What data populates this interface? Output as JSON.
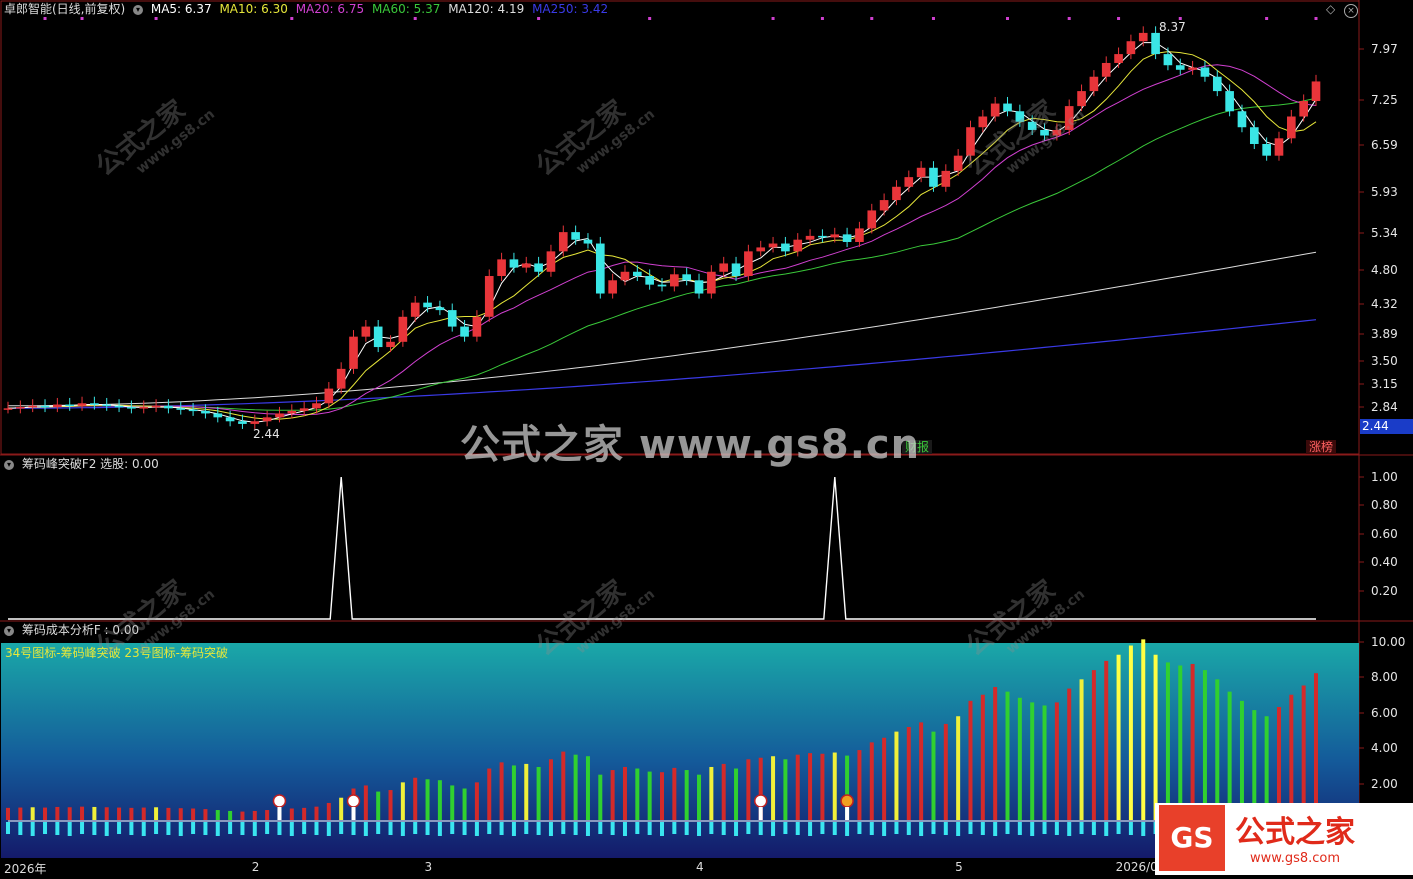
{
  "main_panel": {
    "title": "卓郎智能(日线,前复权)",
    "ma": [
      {
        "label": "MA5: 6.37",
        "color": "#ffffff"
      },
      {
        "label": "MA10: 6.30",
        "color": "#e6e63a"
      },
      {
        "label": "MA20: 6.75",
        "color": "#d040d0"
      },
      {
        "label": "MA60: 5.37",
        "color": "#3ac83a"
      },
      {
        "label": "MA120: 4.19",
        "color": "#dddddd"
      },
      {
        "label": "MA250: 3.42",
        "color": "#3a3ae6"
      }
    ],
    "y_ticks": [
      "7.97",
      "7.25",
      "6.59",
      "5.93",
      "5.34",
      "4.80",
      "4.32",
      "3.89",
      "3.50",
      "3.15",
      "2.84"
    ],
    "current_price": "2.44",
    "high_label": "8.37",
    "low_label": "2.44",
    "tag_finance": "财报",
    "tag_limit": "涨榜"
  },
  "indicator1": {
    "title": "筹码峰突破F2  选股: 0.00",
    "y_ticks": [
      "1.00",
      "0.80",
      "0.60",
      "0.40",
      "0.20"
    ],
    "spikes_at_candle": [
      27,
      67
    ]
  },
  "indicator2": {
    "title": "筹码成本分析F : 0.00",
    "legend": "34号图标-筹码峰突破  23号图标-筹码突破",
    "y_ticks": [
      "10.00",
      "8.00",
      "6.00",
      "4.00",
      "2.00"
    ]
  },
  "x_axis": {
    "labels": [
      {
        "text": "2026年",
        "at": 0
      },
      {
        "text": "2",
        "at": 20
      },
      {
        "text": "3",
        "at": 34
      },
      {
        "text": "4",
        "at": 56
      },
      {
        "text": "5",
        "at": 77
      },
      {
        "text": "2026/05/22/",
        "at": 90
      }
    ]
  },
  "watermark": {
    "center": "公式之家 www.gs8.cn",
    "tile_cn": "公式之家",
    "tile_url": "www.gs8.cn"
  },
  "logo": {
    "mark": "GS",
    "name": "公式之家",
    "url": "www.gs8.com"
  },
  "colors": {
    "up": "#e8353a",
    "down": "#3ae6e6",
    "ma5": "#ffffff",
    "ma10": "#e6e63a",
    "ma20": "#d040d0",
    "ma60": "#3ac83a",
    "ma120": "#dddddd",
    "ma250": "#3a3ae6"
  },
  "chart_data": {
    "type": "candlestick",
    "closes": [
      2.62,
      2.63,
      2.64,
      2.63,
      2.65,
      2.64,
      2.66,
      2.65,
      2.64,
      2.63,
      2.62,
      2.63,
      2.64,
      2.62,
      2.61,
      2.6,
      2.58,
      2.55,
      2.52,
      2.5,
      2.52,
      2.55,
      2.58,
      2.6,
      2.62,
      2.66,
      2.78,
      2.95,
      3.25,
      3.35,
      3.15,
      3.2,
      3.45,
      3.6,
      3.55,
      3.52,
      3.35,
      3.25,
      3.45,
      3.9,
      4.1,
      4.0,
      4.05,
      3.95,
      4.2,
      4.45,
      4.35,
      4.3,
      3.7,
      3.85,
      3.95,
      3.9,
      3.8,
      3.78,
      3.92,
      3.85,
      3.7,
      3.95,
      4.05,
      3.9,
      4.2,
      4.25,
      4.3,
      4.2,
      4.35,
      4.4,
      4.38,
      4.42,
      4.32,
      4.5,
      4.75,
      4.9,
      5.1,
      5.25,
      5.4,
      5.1,
      5.35,
      5.6,
      6.1,
      6.3,
      6.55,
      6.4,
      6.2,
      6.05,
      5.95,
      6.05,
      6.5,
      6.8,
      7.1,
      7.4,
      7.6,
      7.9,
      8.1,
      7.6,
      7.35,
      7.25,
      7.3,
      7.1,
      6.8,
      6.4,
      6.1,
      5.8,
      5.6,
      5.9,
      6.3,
      6.6,
      7.0
    ],
    "ylim": [
      2.44,
      8.37
    ]
  }
}
